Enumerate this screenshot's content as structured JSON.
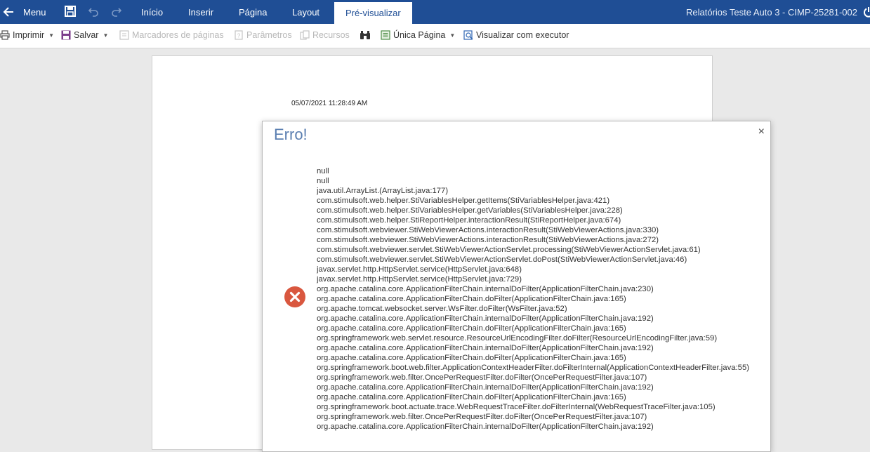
{
  "topbar": {
    "menu_label": "Menu",
    "tabs": [
      {
        "label": "Início"
      },
      {
        "label": "Inserir"
      },
      {
        "label": "Página"
      },
      {
        "label": "Layout"
      },
      {
        "label": "Pré-visualizar"
      }
    ],
    "report_title": "Relatórios Teste Auto 3 - CIMP-25281-002"
  },
  "toolbar": {
    "print_label": "Imprimir",
    "save_label": "Salvar",
    "bookmarks_label": "Marcadores de páginas",
    "params_label": "Parâmetros",
    "resources_label": "Recursos",
    "view_mode_label": "Única Página",
    "viewer_label": "Visualizar com executor"
  },
  "page": {
    "timestamp": "05/07/2021 11:28:49 AM"
  },
  "dialog": {
    "title": "Erro!",
    "close_glyph": "×",
    "trace": [
      "null",
      "null",
      "java.util.ArrayList.(ArrayList.java:177)",
      "com.stimulsoft.web.helper.StiVariablesHelper.getItems(StiVariablesHelper.java:421)",
      "com.stimulsoft.web.helper.StiVariablesHelper.getVariables(StiVariablesHelper.java:228)",
      "com.stimulsoft.web.helper.StiReportHelper.interactionResult(StiReportHelper.java:674)",
      "com.stimulsoft.webviewer.StiWebViewerActions.interactionResult(StiWebViewerActions.java:330)",
      "com.stimulsoft.webviewer.StiWebViewerActions.interactionResult(StiWebViewerActions.java:272)",
      "com.stimulsoft.webviewer.servlet.StiWebViewerActionServlet.processing(StiWebViewerActionServlet.java:61)",
      "com.stimulsoft.webviewer.servlet.StiWebViewerActionServlet.doPost(StiWebViewerActionServlet.java:46)",
      "javax.servlet.http.HttpServlet.service(HttpServlet.java:648)",
      "javax.servlet.http.HttpServlet.service(HttpServlet.java:729)",
      "org.apache.catalina.core.ApplicationFilterChain.internalDoFilter(ApplicationFilterChain.java:230)",
      "org.apache.catalina.core.ApplicationFilterChain.doFilter(ApplicationFilterChain.java:165)",
      "org.apache.tomcat.websocket.server.WsFilter.doFilter(WsFilter.java:52)",
      "org.apache.catalina.core.ApplicationFilterChain.internalDoFilter(ApplicationFilterChain.java:192)",
      "org.apache.catalina.core.ApplicationFilterChain.doFilter(ApplicationFilterChain.java:165)",
      "org.springframework.web.servlet.resource.ResourceUrlEncodingFilter.doFilter(ResourceUrlEncodingFilter.java:59)",
      "org.apache.catalina.core.ApplicationFilterChain.internalDoFilter(ApplicationFilterChain.java:192)",
      "org.apache.catalina.core.ApplicationFilterChain.doFilter(ApplicationFilterChain.java:165)",
      "org.springframework.boot.web.filter.ApplicationContextHeaderFilter.doFilterInternal(ApplicationContextHeaderFilter.java:55)",
      "org.springframework.web.filter.OncePerRequestFilter.doFilter(OncePerRequestFilter.java:107)",
      "org.apache.catalina.core.ApplicationFilterChain.internalDoFilter(ApplicationFilterChain.java:192)",
      "org.apache.catalina.core.ApplicationFilterChain.doFilter(ApplicationFilterChain.java:165)",
      "org.springframework.boot.actuate.trace.WebRequestTraceFilter.doFilterInternal(WebRequestTraceFilter.java:105)",
      "org.springframework.web.filter.OncePerRequestFilter.doFilter(OncePerRequestFilter.java:107)",
      "org.apache.catalina.core.ApplicationFilterChain.internalDoFilter(ApplicationFilterChain.java:192)"
    ]
  },
  "icons": {
    "back": "arrow-left-icon",
    "save": "floppy-disk-icon",
    "undo": "undo-icon",
    "redo": "redo-icon",
    "print": "printer-icon",
    "bookmarks": "bookmark-icon",
    "params": "parameters-icon",
    "resources": "resources-icon",
    "find": "binoculars-icon",
    "page": "single-page-icon",
    "viewer": "viewer-icon",
    "error": "error-circle-icon"
  },
  "colors": {
    "topbar_bg": "#1f4e95",
    "dialog_title": "#5b7fb1",
    "error_icon": "#d9573f"
  }
}
